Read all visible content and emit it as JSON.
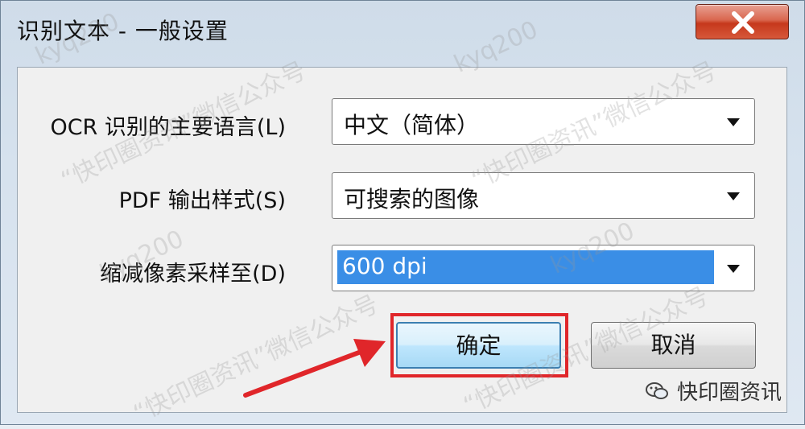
{
  "window": {
    "title": "识别文本 - 一般设置"
  },
  "form": {
    "ocr_language": {
      "label": "OCR 识别的主要语言(L)",
      "value": "中文（简体）"
    },
    "pdf_style": {
      "label": "PDF 输出样式(S)",
      "value": "可搜索的图像"
    },
    "downsample": {
      "label": "缩减像素采样至(D)",
      "value": "600 dpi"
    }
  },
  "buttons": {
    "ok": "确定",
    "cancel": "取消"
  },
  "watermark": {
    "id": "kyq200",
    "wechat": "“快印圈资讯”微信公众号",
    "brand": "快印圈资讯"
  },
  "colors": {
    "annotation": "#e0262a",
    "selection": "#3a8ee6",
    "close": "#c6381c"
  }
}
